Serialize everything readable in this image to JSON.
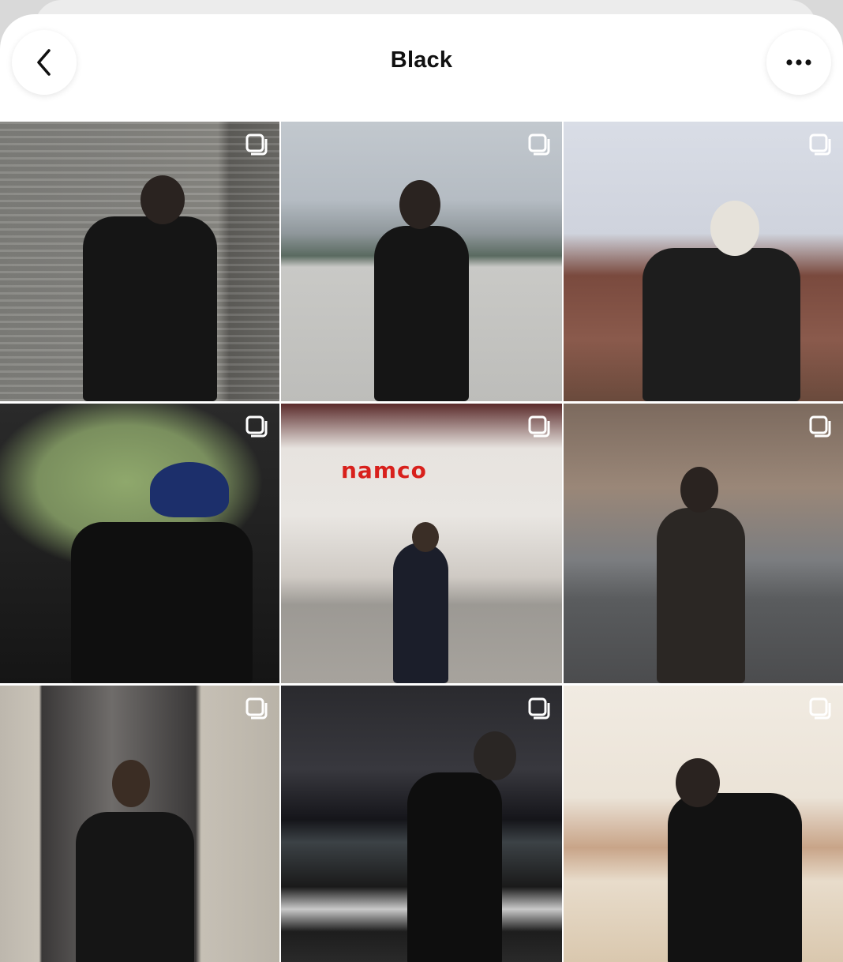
{
  "header": {
    "title": "Black",
    "back_icon": "chevron-left-icon",
    "more_icon": "ellipsis-icon"
  },
  "grid": {
    "tiles": [
      {
        "label": "",
        "badge_icon": "multiple-images-icon"
      },
      {
        "label": "",
        "badge_icon": "multiple-images-icon"
      },
      {
        "label": "",
        "badge_icon": "multiple-images-icon"
      },
      {
        "label": "",
        "badge_icon": "multiple-images-icon"
      },
      {
        "label": "namco",
        "badge_icon": "multiple-images-icon"
      },
      {
        "label": "",
        "badge_icon": "multiple-images-icon"
      },
      {
        "label": "",
        "badge_icon": "multiple-images-icon"
      },
      {
        "label": "",
        "badge_icon": "multiple-images-icon"
      },
      {
        "label": "",
        "badge_icon": "multiple-images-icon"
      }
    ]
  },
  "colors": {
    "background": "#ffffff",
    "title_text": "#111111",
    "namco_red": "#d8201c"
  }
}
